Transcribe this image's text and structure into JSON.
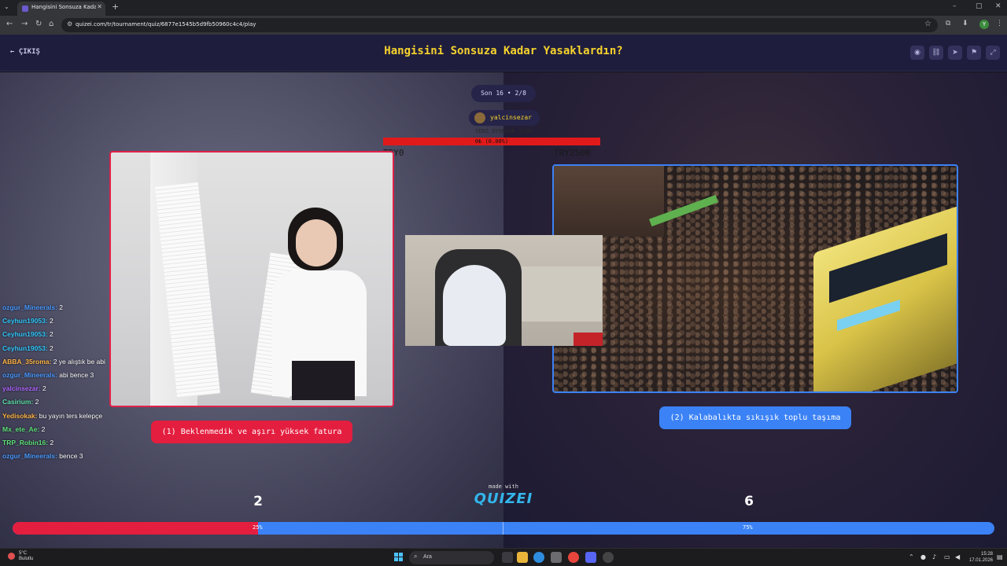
{
  "browser": {
    "tab_title": "Hangisini Sonsuza Kadar Yasakla",
    "url": "quizei.com/tr/tournament/quiz/6877e1545b5d9fb50960c4c4/play",
    "profile_initial": "Y"
  },
  "header": {
    "back_label": "← ÇIKIŞ",
    "title": "Hangisini Sonsuza Kadar Yasaklardın?",
    "actions": [
      "eye-icon",
      "link-icon",
      "send-icon",
      "flag-icon",
      "fullscreen-icon"
    ]
  },
  "round": {
    "label": "Son 16 • 2/8",
    "username": "yalcinsezar"
  },
  "goal": {
    "label": "YENİ OYUNLAR İÇİN",
    "amount": "0₺ (0.00%)",
    "min": "TRY0",
    "max": "TRY2500"
  },
  "options": {
    "left_label": "(1) Beklenmedik ve aşırı yüksek fatura",
    "right_label": "(2) Kalabalıkta sıkışık toplu taşıma"
  },
  "chat": [
    {
      "user": "ozgur_Mineerals:",
      "msg": " 2",
      "color": "#4a9bff"
    },
    {
      "user": "Ceyhun19053:",
      "msg": " 2",
      "color": "#33c9ff"
    },
    {
      "user": "Ceyhun19053:",
      "msg": " 2",
      "color": "#33c9ff"
    },
    {
      "user": "Ceyhun19053:",
      "msg": " 2",
      "color": "#33c9ff"
    },
    {
      "user": "ABBA_35roma:",
      "msg": " 2 ye alıştık be abi",
      "color": "#ffb547"
    },
    {
      "user": "ozgur_Mineerals:",
      "msg": " abi bence 3",
      "color": "#4a9bff"
    },
    {
      "user": "yalcinsezar:",
      "msg": " 2",
      "color": "#b067ff"
    },
    {
      "user": "Casirium:",
      "msg": " 2",
      "color": "#5fe0a8"
    },
    {
      "user": "Yedisokak:",
      "msg": " bu yayın ters kelepçe",
      "color": "#ffb547"
    },
    {
      "user": "Mx_ete_Ae:",
      "msg": " 2",
      "color": "#5fe07a"
    },
    {
      "user": "TRP_Robin16:",
      "msg": " 2",
      "color": "#5fe07a"
    },
    {
      "user": "ozgur_Mineerals:",
      "msg": " bence 3",
      "color": "#4a9bff"
    }
  ],
  "branding": {
    "made_with": "made with",
    "logo": "QUIZEI"
  },
  "votes": {
    "left_count": "2",
    "right_count": "6",
    "left_pct_label": "25%",
    "right_pct_label": "75%",
    "left_fraction": 0.25
  },
  "taskbar": {
    "weather_temp": "5°C",
    "weather_desc": "Bulutlu",
    "search": "Ara",
    "time": "15:28",
    "date": "17.01.2026"
  }
}
